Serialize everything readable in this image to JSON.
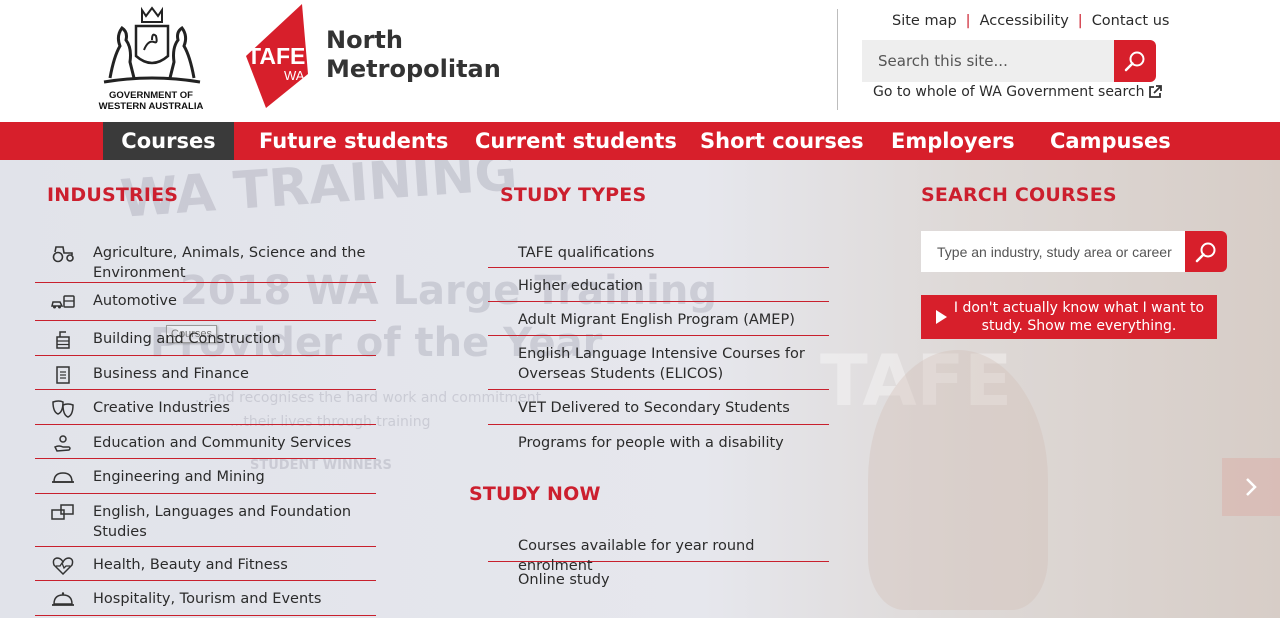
{
  "header": {
    "gov_logo_text_line1": "GOVERNMENT OF",
    "gov_logo_text_line2": "WESTERN AUSTRALIA",
    "tafe_logo_text": "TAFE",
    "tafe_logo_subtext": "WA",
    "org_name_line1": "North",
    "org_name_line2": "Metropolitan",
    "utility_links": [
      "Site map",
      "Accessibility",
      "Contact us"
    ],
    "site_search_placeholder": "Search this site...",
    "wa_search_link": "Go to whole of WA Government search"
  },
  "nav": {
    "items": [
      "Courses",
      "Future students",
      "Current students",
      "Short courses",
      "Employers",
      "Campuses"
    ],
    "active": "Courses",
    "tooltip": "Courses"
  },
  "background_ghost": {
    "line1": "WA TRAINING",
    "line2": "2018 WA Large Training",
    "line3": "Provider of the Year",
    "line4": "...and recognises the hard work and commitment",
    "line5": "...their lives through training",
    "line6": "STUDENT WINNERS",
    "line7": "TAFE"
  },
  "industries": {
    "heading": "INDUSTRIES",
    "items": [
      {
        "label": "Agriculture, Animals, Science and the Environment",
        "icon": "tractor-icon"
      },
      {
        "label": "Automotive",
        "icon": "car-bus-icon"
      },
      {
        "label": "Building and Construction",
        "icon": "building-icon"
      },
      {
        "label": "Business and Finance",
        "icon": "document-icon"
      },
      {
        "label": "Creative Industries",
        "icon": "theatre-masks-icon"
      },
      {
        "label": "Education and Community Services",
        "icon": "hand-person-icon"
      },
      {
        "label": "Engineering and Mining",
        "icon": "hard-hat-icon"
      },
      {
        "label": "English, Languages and Foundation Studies",
        "icon": "speech-bubbles-icon"
      },
      {
        "label": "Health, Beauty and Fitness",
        "icon": "heartbeat-icon"
      },
      {
        "label": "Hospitality, Tourism and Events",
        "icon": "cloche-icon"
      }
    ]
  },
  "study_types": {
    "heading": "STUDY TYPES",
    "items": [
      "TAFE qualifications",
      "Higher education",
      "Adult Migrant English Program (AMEP)",
      "English Language Intensive Courses for Overseas Students (ELICOS)",
      "VET Delivered to Secondary Students",
      "Programs for people with a disability"
    ]
  },
  "study_now": {
    "heading": "STUDY NOW",
    "items": [
      "Courses available for year round enrolment",
      "Online study"
    ]
  },
  "search_courses": {
    "heading": "SEARCH COURSES",
    "placeholder": "Type an industry, study area or career",
    "dont_know_button": "I don't actually know what I want to study. Show me everything."
  },
  "colors": {
    "brand_red": "#d71f2b",
    "nav_active": "#3a3a3a",
    "heading_red": "#cc1f2e",
    "text": "#2b2b2b"
  }
}
